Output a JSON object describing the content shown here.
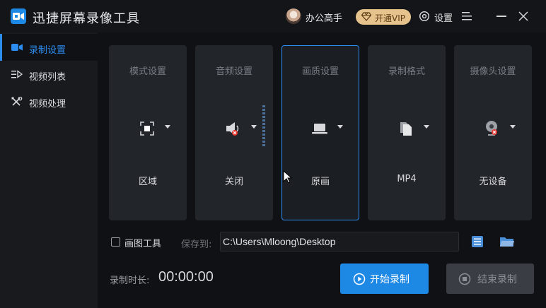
{
  "titlebar": {
    "app_title": "迅捷屏幕录像工具",
    "username": "办公高手",
    "vip_label": "开通VIP",
    "settings_label": "设置"
  },
  "sidebar": {
    "items": [
      {
        "label": "录制设置",
        "icon": "video-camera-icon",
        "active": true
      },
      {
        "label": "视频列表",
        "icon": "play-list-icon",
        "active": false
      },
      {
        "label": "视频处理",
        "icon": "tools-icon",
        "active": false
      }
    ]
  },
  "cards": [
    {
      "title": "模式设置",
      "value": "区域",
      "icon": "region-select-icon"
    },
    {
      "title": "音频设置",
      "value": "关闭",
      "icon": "speaker-muted-icon"
    },
    {
      "title": "画质设置",
      "value": "原画",
      "icon": "laptop-icon",
      "selected": true
    },
    {
      "title": "录制格式",
      "value": "MP4",
      "icon": "file-icon"
    },
    {
      "title": "摄像头设置",
      "value": "无设备",
      "icon": "webcam-disabled-icon"
    }
  ],
  "options": {
    "draw_tool_label": "画图工具",
    "draw_tool_checked": false,
    "save_label": "保存到:",
    "save_path": "C:\\Users\\Mloong\\Desktop"
  },
  "footer": {
    "duration_label": "录制时长:",
    "duration_value": "00:00:00",
    "start_label": "开始录制",
    "stop_label": "结束录制"
  },
  "colors": {
    "accent": "#1e88e5",
    "vip": "#e6c38d",
    "background": "#0f1114",
    "card": "#22252a"
  }
}
